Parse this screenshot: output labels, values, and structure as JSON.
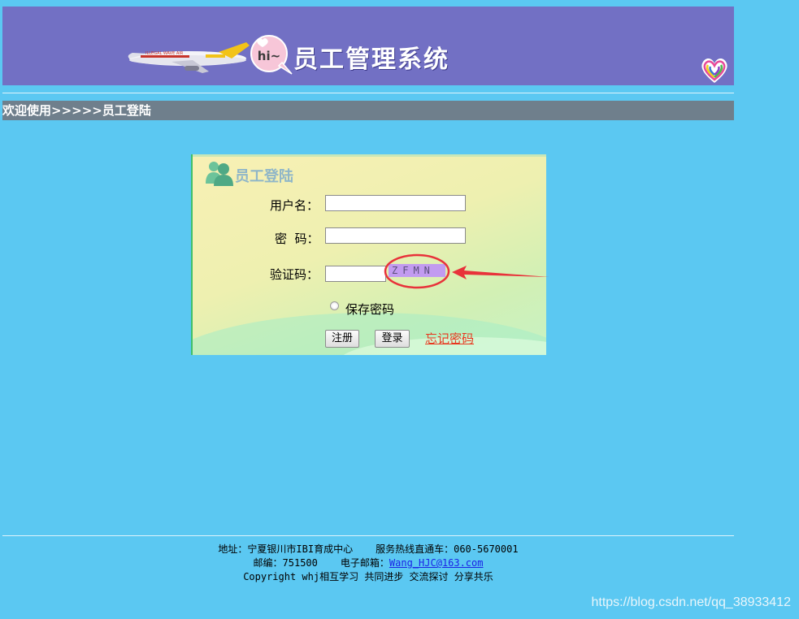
{
  "banner": {
    "title": "员工管理系统",
    "hi_text": "hi~",
    "colors": {
      "background": "#7270c4",
      "page": "#5bc8f2"
    },
    "icons": [
      "airplane-icon",
      "hi-bubble-icon",
      "rainbow-heart-icon"
    ]
  },
  "breadcrumb": {
    "text": "欢迎使用>>>>>员工登陆",
    "background": "#6f7f8c"
  },
  "login": {
    "title": "员工登陆",
    "username_label": "用户名：",
    "username_value": "",
    "password_label": "密  码：",
    "password_value": "",
    "captcha_label": "验证码：",
    "captcha_value": "",
    "captcha_code": "ZFMN",
    "remember_label": "保存密码",
    "remember_checked": false,
    "register_button": "注册",
    "login_button": "登录",
    "forgot_link": "忘记密码"
  },
  "footer": {
    "address": "地址：宁夏银川市IBI育成中心",
    "hotline": "服务热线直通车：060-5670001",
    "postcode": "邮编：751500",
    "email_label": "电子邮箱：",
    "email": "Wang_HJC@163.com",
    "copyright": "Copyright whj相互学习 共同进步 交流探讨 分享共乐"
  },
  "watermark": "https://blog.csdn.net/qq_38933412"
}
